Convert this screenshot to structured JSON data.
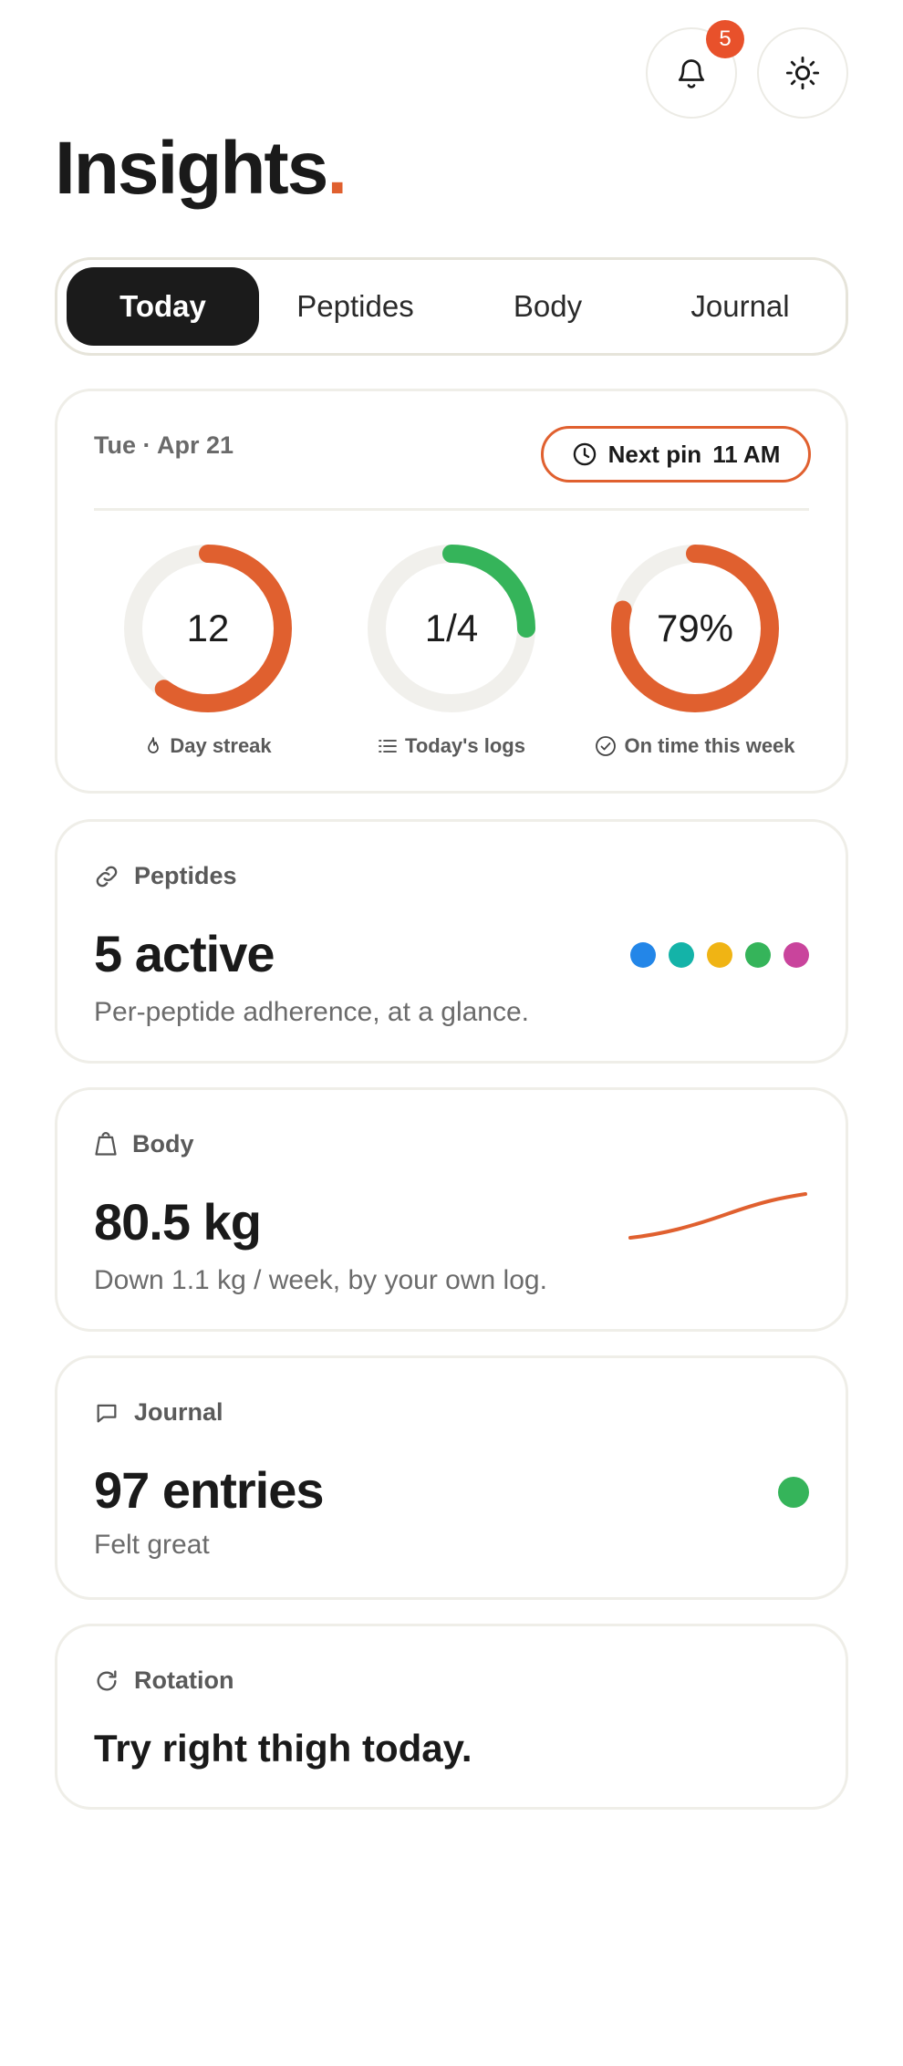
{
  "header": {
    "notifications_count": "5",
    "notification_icon": "bell-icon",
    "theme_icon": "sun-icon"
  },
  "page": {
    "title": "Insights",
    "title_dot": "."
  },
  "tabs": [
    {
      "label": "Today",
      "active": true
    },
    {
      "label": "Peptides",
      "active": false
    },
    {
      "label": "Body",
      "active": false
    },
    {
      "label": "Journal",
      "active": false
    }
  ],
  "today": {
    "date": "Tue · Apr 21",
    "next_pin_label": "Next pin",
    "next_pin_time": "11 AM",
    "rings": [
      {
        "value": "12",
        "caption": "Day streak",
        "icon": "flame-icon",
        "progress": 0.6,
        "color": "#e0602f"
      },
      {
        "value": "1/4",
        "caption": "Today's logs",
        "icon": "list-icon",
        "progress": 0.25,
        "color": "#35b45a"
      },
      {
        "value": "79%",
        "caption": "On time this week",
        "icon": "check-circle-icon",
        "progress": 0.79,
        "color": "#e0602f"
      }
    ]
  },
  "peptides": {
    "heading": "Peptides",
    "icon": "link-icon",
    "value": "5 active",
    "subtitle": "Per-peptide adherence, at a glance.",
    "dot_colors": [
      "#2386e8",
      "#14b3a8",
      "#f0b414",
      "#35b45a",
      "#c9449c"
    ]
  },
  "body": {
    "heading": "Body",
    "icon": "weight-icon",
    "value": "80.5 kg",
    "subtitle": "Down 1.1 kg / week, by your own log.",
    "trend_color": "#e0602f"
  },
  "journal": {
    "heading": "Journal",
    "icon": "message-icon",
    "value": "97 entries",
    "subtitle": "Felt great",
    "mood_color": "#35b45a"
  },
  "rotation": {
    "heading": "Rotation",
    "icon": "refresh-icon",
    "text": "Try right thigh today."
  },
  "colors": {
    "accent": "#e0602f",
    "success": "#35b45a",
    "badge": "#e8512b"
  }
}
